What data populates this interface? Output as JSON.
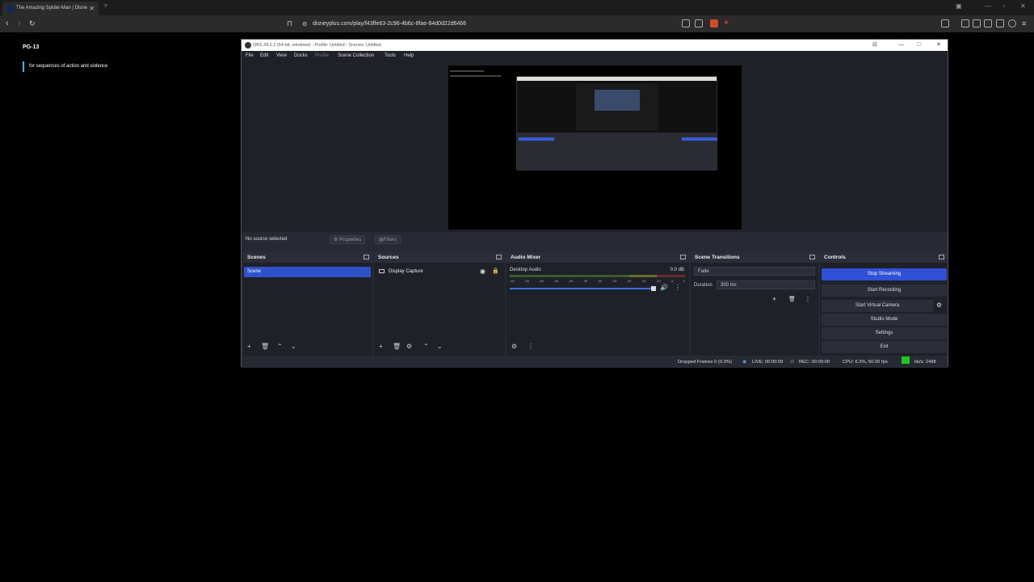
{
  "browser": {
    "tab_title": "The Amazing Spider-Man | Disne",
    "tab_close": "✕",
    "new_tab": "+",
    "url": "disneyplus.com/play/f43ffe63-2c96-4b6c-8fae-84d0d22d6466"
  },
  "page": {
    "rating": "PG-13",
    "reason": "for sequences of action and violence"
  },
  "obs": {
    "title": "OBS 28.1.2 (64-bit, windows) - Profile: Untitled - Scenes: Untitled",
    "menu": [
      "File",
      "Edit",
      "View",
      "Docks",
      "Profile",
      "Scene Collection",
      "Tools",
      "Help"
    ],
    "no_source": "No source selected",
    "properties_btn": "Properties",
    "filters_btn": "Filters",
    "scenes": {
      "header": "Scenes",
      "items": [
        "Scene"
      ]
    },
    "sources": {
      "header": "Sources",
      "items": [
        "Display Capture"
      ]
    },
    "mixer": {
      "header": "Audio Mixer",
      "channel": "Desktop Audio",
      "level": "0.0 dB",
      "ticks": [
        "-60",
        "-55",
        "-50",
        "-45",
        "-40",
        "-35",
        "-30",
        "-25",
        "-20",
        "-15",
        "-10",
        "-5",
        "0"
      ],
      "volume_fraction": 0.97
    },
    "transitions": {
      "header": "Scene Transitions",
      "type": "Fade",
      "duration_label": "Duration",
      "duration": "300 ms"
    },
    "controls": {
      "header": "Controls",
      "buttons": [
        "Stop Streaming",
        "Start Recording",
        "Start Virtual Camera",
        "Studio Mode",
        "Settings",
        "Exit"
      ]
    },
    "status": {
      "dropped": "Dropped Frames 0 (0.0%)",
      "live": "LIVE: 00:00:09",
      "rec": "REC: 00:00:00",
      "cpu": "CPU: 6.3%, 60.00 fps",
      "kbs": "kb/s: 2498"
    },
    "accent_color": "#3050d8",
    "live_indicator_color": "#1ec81e"
  }
}
